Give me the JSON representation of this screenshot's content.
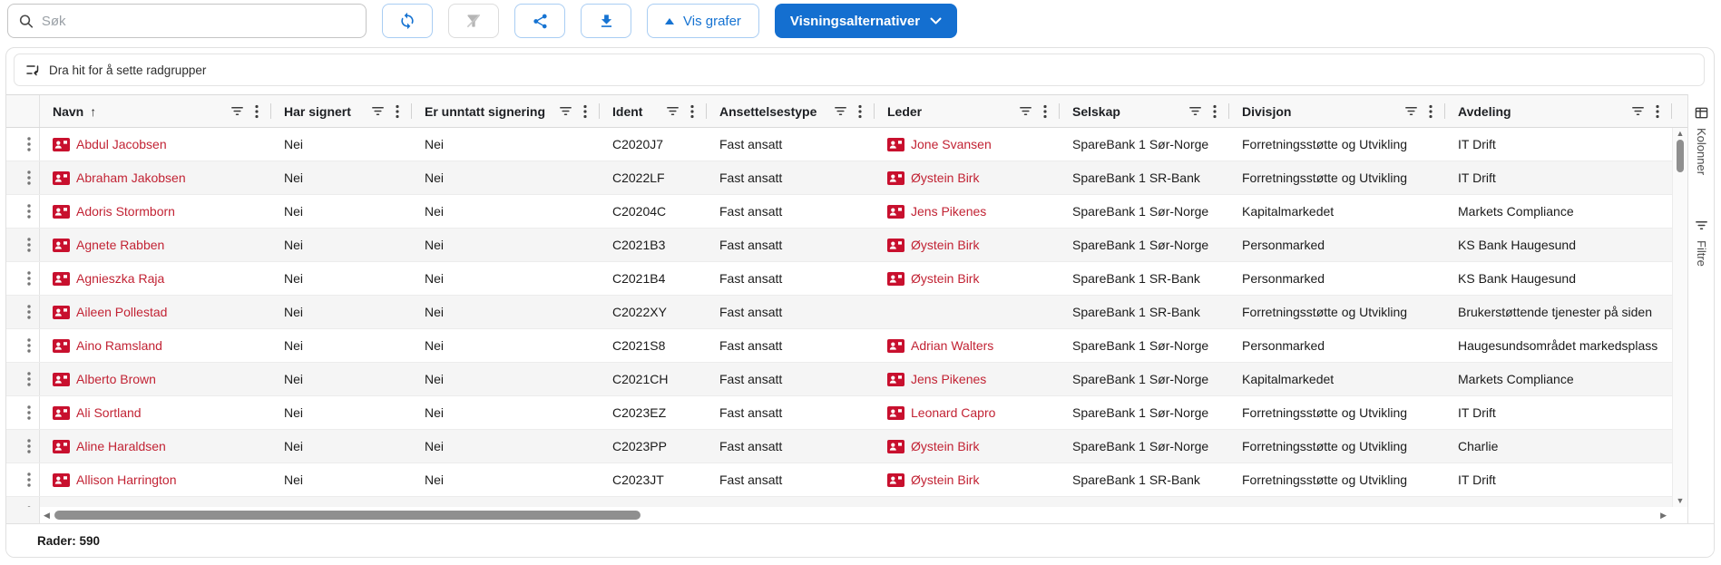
{
  "toolbar": {
    "search_placeholder": "Søk",
    "vis_grafer_label": "Vis grafer",
    "visningsalternativer_label": "Visningsalternativer"
  },
  "row_group_panel": {
    "label": "Dra hit for å sette radgrupper"
  },
  "grid": {
    "columns": [
      {
        "id": "navn",
        "label": "Navn",
        "sorted": "asc"
      },
      {
        "id": "har_signert",
        "label": "Har signert"
      },
      {
        "id": "er_unntatt_signering",
        "label": "Er unntatt signering"
      },
      {
        "id": "ident",
        "label": "Ident"
      },
      {
        "id": "ansettelsestype",
        "label": "Ansettelsestype"
      },
      {
        "id": "leder",
        "label": "Leder"
      },
      {
        "id": "selskap",
        "label": "Selskap"
      },
      {
        "id": "divisjon",
        "label": "Divisjon"
      },
      {
        "id": "avdeling",
        "label": "Avdeling"
      }
    ],
    "rows": [
      {
        "navn": "Abdul Jacobsen",
        "har_signert": "Nei",
        "er_unntatt_signering": "Nei",
        "ident": "C2020J7",
        "ansettelsestype": "Fast ansatt",
        "leder": "Jone Svansen",
        "selskap": "SpareBank 1 Sør-Norge",
        "divisjon": "Forretningsstøtte og Utvikling",
        "avdeling": "IT Drift"
      },
      {
        "navn": "Abraham Jakobsen",
        "har_signert": "Nei",
        "er_unntatt_signering": "Nei",
        "ident": "C2022LF",
        "ansettelsestype": "Fast ansatt",
        "leder": "Øystein Birk",
        "selskap": "SpareBank 1 SR-Bank",
        "divisjon": "Forretningsstøtte og Utvikling",
        "avdeling": "IT Drift"
      },
      {
        "navn": "Adoris Stormborn",
        "har_signert": "Nei",
        "er_unntatt_signering": "Nei",
        "ident": "C20204C",
        "ansettelsestype": "Fast ansatt",
        "leder": "Jens Pikenes",
        "selskap": "SpareBank 1 Sør-Norge",
        "divisjon": "Kapitalmarkedet",
        "avdeling": "Markets Compliance"
      },
      {
        "navn": "Agnete Rabben",
        "har_signert": "Nei",
        "er_unntatt_signering": "Nei",
        "ident": "C2021B3",
        "ansettelsestype": "Fast ansatt",
        "leder": "Øystein Birk",
        "selskap": "SpareBank 1 Sør-Norge",
        "divisjon": "Personmarked",
        "avdeling": "KS Bank Haugesund"
      },
      {
        "navn": "Agnieszka Raja",
        "har_signert": "Nei",
        "er_unntatt_signering": "Nei",
        "ident": "C2021B4",
        "ansettelsestype": "Fast ansatt",
        "leder": "Øystein Birk",
        "selskap": "SpareBank 1 SR-Bank",
        "divisjon": "Personmarked",
        "avdeling": "KS Bank Haugesund"
      },
      {
        "navn": "Aileen Pollestad",
        "har_signert": "Nei",
        "er_unntatt_signering": "Nei",
        "ident": "C2022XY",
        "ansettelsestype": "Fast ansatt",
        "leder": "",
        "selskap": "SpareBank 1 SR-Bank",
        "divisjon": "Forretningsstøtte og Utvikling",
        "avdeling": "Brukerstøttende tjenester på siden"
      },
      {
        "navn": "Aino Ramsland",
        "har_signert": "Nei",
        "er_unntatt_signering": "Nei",
        "ident": "C2021S8",
        "ansettelsestype": "Fast ansatt",
        "leder": "Adrian Walters",
        "selskap": "SpareBank 1 Sør-Norge",
        "divisjon": "Personmarked",
        "avdeling": "Haugesundsområdet markedsplass"
      },
      {
        "navn": "Alberto Brown",
        "har_signert": "Nei",
        "er_unntatt_signering": "Nei",
        "ident": "C2021CH",
        "ansettelsestype": "Fast ansatt",
        "leder": "Jens Pikenes",
        "selskap": "SpareBank 1 Sør-Norge",
        "divisjon": "Kapitalmarkedet",
        "avdeling": "Markets Compliance"
      },
      {
        "navn": "Ali Sortland",
        "har_signert": "Nei",
        "er_unntatt_signering": "Nei",
        "ident": "C2023EZ",
        "ansettelsestype": "Fast ansatt",
        "leder": "Leonard Capro",
        "selskap": "SpareBank 1 Sør-Norge",
        "divisjon": "Forretningsstøtte og Utvikling",
        "avdeling": "IT Drift"
      },
      {
        "navn": "Aline Haraldsen",
        "har_signert": "Nei",
        "er_unntatt_signering": "Nei",
        "ident": "C2023PP",
        "ansettelsestype": "Fast ansatt",
        "leder": "Øystein Birk",
        "selskap": "SpareBank 1 Sør-Norge",
        "divisjon": "Forretningsstøtte og Utvikling",
        "avdeling": "Charlie"
      },
      {
        "navn": "Allison Harrington",
        "har_signert": "Nei",
        "er_unntatt_signering": "Nei",
        "ident": "C2023JT",
        "ansettelsestype": "Fast ansatt",
        "leder": "Øystein Birk",
        "selskap": "SpareBank 1 SR-Bank",
        "divisjon": "Forretningsstøtte og Utvikling",
        "avdeling": "IT Drift"
      }
    ]
  },
  "sidebar": {
    "tabs": [
      {
        "label": "Kolonner"
      },
      {
        "label": "Filtre"
      }
    ]
  },
  "footer": {
    "row_count": "Rader: 590"
  },
  "icons": {
    "search-icon": "magnifier",
    "refresh-icon": "circular sync arrows",
    "filter-off-icon": "funnel with slash",
    "share-icon": "share nodes",
    "download-icon": "arrow down to bar",
    "triangle-up-icon": "▲",
    "chevron-down-icon": "⌄",
    "row-group-icon": "lines with return arrow",
    "filter-lines-icon": "stacked shrinking lines",
    "column-menu-icon": "⋮",
    "row-menu-icon": "⋮",
    "sort-asc-icon": "↑",
    "contact-card-icon": "red id-card with person",
    "columns-icon": "table grid"
  },
  "colors": {
    "accent_blue": "#146fd0",
    "brand_red": "#c8102e",
    "link_red": "#c22334",
    "row_alt": "#f5f5f5"
  }
}
